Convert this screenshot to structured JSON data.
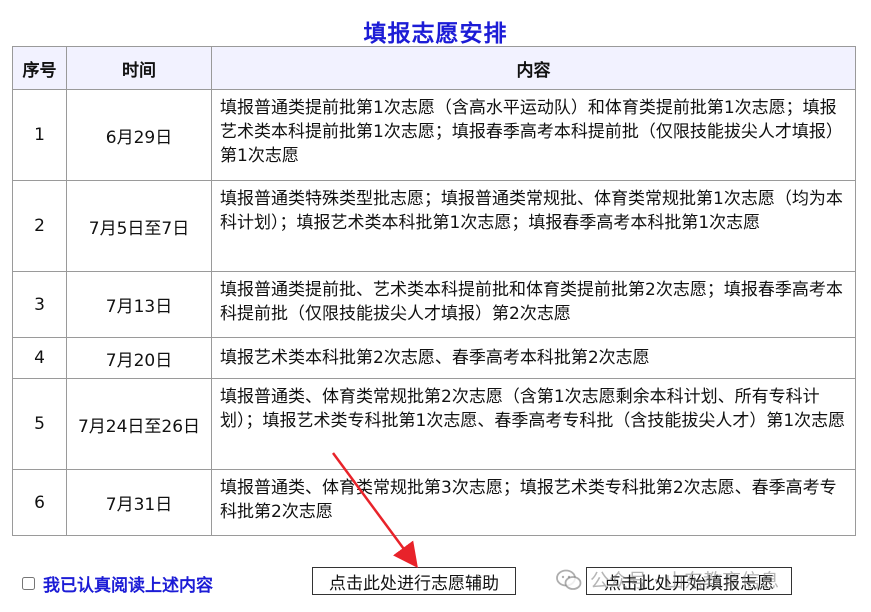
{
  "title": "填报志愿安排",
  "table": {
    "headers": [
      "序号",
      "时间",
      "内容"
    ],
    "rows": [
      {
        "num": "1",
        "date": "6月29日",
        "content": "填报普通类提前批第1次志愿（含高水平运动队）和体育类提前批第1次志愿；填报艺术类本科提前批第1次志愿；填报春季高考本科提前批（仅限技能拔尖人才填报）第1次志愿"
      },
      {
        "num": "2",
        "date": "7月5日至7日",
        "content": "填报普通类特殊类型批志愿；填报普通类常规批、体育类常规批第1次志愿（均为本科计划）；填报艺术类本科批第1次志愿；填报春季高考本科批第1次志愿"
      },
      {
        "num": "3",
        "date": "7月13日",
        "content": "填报普通类提前批、艺术类本科提前批和体育类提前批第2次志愿；填报春季高考本科提前批（仅限技能拔尖人才填报）第2次志愿"
      },
      {
        "num": "4",
        "date": "7月20日",
        "content": "填报艺术类本科批第2次志愿、春季高考本科批第2次志愿"
      },
      {
        "num": "5",
        "date": "7月24日至26日",
        "content": "填报普通类、体育类常规批第2次志愿（含第1次志愿剩余本科计划、所有专科计划）；填报艺术类专科批第1次志愿、春季高考专科批（含技能拔尖人才）第1次志愿"
      },
      {
        "num": "6",
        "date": "7月31日",
        "content": "填报普通类、体育类常规批第3次志愿；填报艺术类专科批第2次志愿、春季高考专科批第2次志愿"
      }
    ]
  },
  "footer": {
    "agree_label": "我已认真阅读上述内容",
    "assist_button": "点击此处进行志愿辅助",
    "fill_button": "点击此处开始填报志愿"
  },
  "watermark": "公众号 · 山东教育信息",
  "colors": {
    "title": "#1c1cd6",
    "agree_label": "#1c1cd6",
    "header_bg": "#f2f2ff",
    "arrow": "#e8232a"
  }
}
